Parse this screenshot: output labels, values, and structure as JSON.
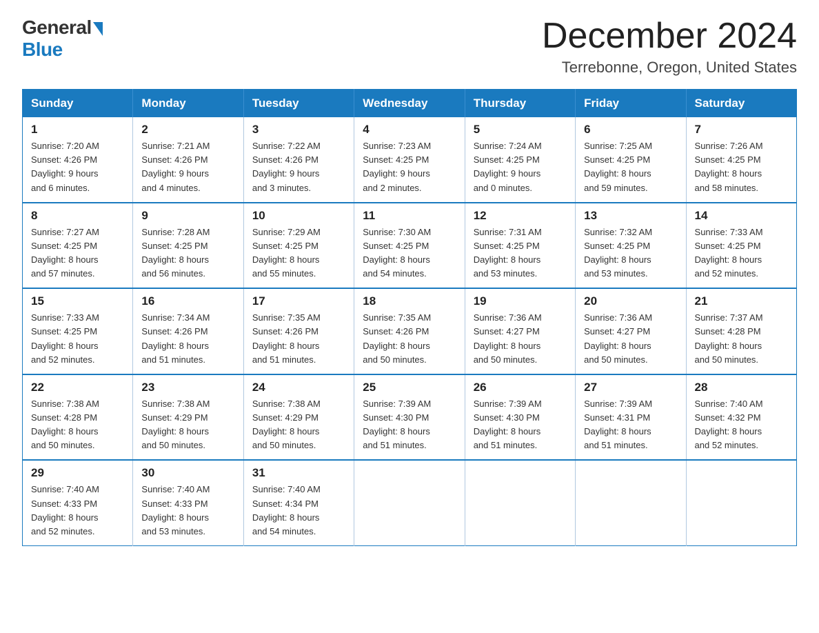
{
  "logo": {
    "general": "General",
    "blue": "Blue"
  },
  "title": {
    "month": "December 2024",
    "location": "Terrebonne, Oregon, United States"
  },
  "weekdays": [
    "Sunday",
    "Monday",
    "Tuesday",
    "Wednesday",
    "Thursday",
    "Friday",
    "Saturday"
  ],
  "weeks": [
    [
      {
        "day": "1",
        "sunrise": "7:20 AM",
        "sunset": "4:26 PM",
        "daylight": "9 hours and 6 minutes."
      },
      {
        "day": "2",
        "sunrise": "7:21 AM",
        "sunset": "4:26 PM",
        "daylight": "9 hours and 4 minutes."
      },
      {
        "day": "3",
        "sunrise": "7:22 AM",
        "sunset": "4:26 PM",
        "daylight": "9 hours and 3 minutes."
      },
      {
        "day": "4",
        "sunrise": "7:23 AM",
        "sunset": "4:25 PM",
        "daylight": "9 hours and 2 minutes."
      },
      {
        "day": "5",
        "sunrise": "7:24 AM",
        "sunset": "4:25 PM",
        "daylight": "9 hours and 0 minutes."
      },
      {
        "day": "6",
        "sunrise": "7:25 AM",
        "sunset": "4:25 PM",
        "daylight": "8 hours and 59 minutes."
      },
      {
        "day": "7",
        "sunrise": "7:26 AM",
        "sunset": "4:25 PM",
        "daylight": "8 hours and 58 minutes."
      }
    ],
    [
      {
        "day": "8",
        "sunrise": "7:27 AM",
        "sunset": "4:25 PM",
        "daylight": "8 hours and 57 minutes."
      },
      {
        "day": "9",
        "sunrise": "7:28 AM",
        "sunset": "4:25 PM",
        "daylight": "8 hours and 56 minutes."
      },
      {
        "day": "10",
        "sunrise": "7:29 AM",
        "sunset": "4:25 PM",
        "daylight": "8 hours and 55 minutes."
      },
      {
        "day": "11",
        "sunrise": "7:30 AM",
        "sunset": "4:25 PM",
        "daylight": "8 hours and 54 minutes."
      },
      {
        "day": "12",
        "sunrise": "7:31 AM",
        "sunset": "4:25 PM",
        "daylight": "8 hours and 53 minutes."
      },
      {
        "day": "13",
        "sunrise": "7:32 AM",
        "sunset": "4:25 PM",
        "daylight": "8 hours and 53 minutes."
      },
      {
        "day": "14",
        "sunrise": "7:33 AM",
        "sunset": "4:25 PM",
        "daylight": "8 hours and 52 minutes."
      }
    ],
    [
      {
        "day": "15",
        "sunrise": "7:33 AM",
        "sunset": "4:25 PM",
        "daylight": "8 hours and 52 minutes."
      },
      {
        "day": "16",
        "sunrise": "7:34 AM",
        "sunset": "4:26 PM",
        "daylight": "8 hours and 51 minutes."
      },
      {
        "day": "17",
        "sunrise": "7:35 AM",
        "sunset": "4:26 PM",
        "daylight": "8 hours and 51 minutes."
      },
      {
        "day": "18",
        "sunrise": "7:35 AM",
        "sunset": "4:26 PM",
        "daylight": "8 hours and 50 minutes."
      },
      {
        "day": "19",
        "sunrise": "7:36 AM",
        "sunset": "4:27 PM",
        "daylight": "8 hours and 50 minutes."
      },
      {
        "day": "20",
        "sunrise": "7:36 AM",
        "sunset": "4:27 PM",
        "daylight": "8 hours and 50 minutes."
      },
      {
        "day": "21",
        "sunrise": "7:37 AM",
        "sunset": "4:28 PM",
        "daylight": "8 hours and 50 minutes."
      }
    ],
    [
      {
        "day": "22",
        "sunrise": "7:38 AM",
        "sunset": "4:28 PM",
        "daylight": "8 hours and 50 minutes."
      },
      {
        "day": "23",
        "sunrise": "7:38 AM",
        "sunset": "4:29 PM",
        "daylight": "8 hours and 50 minutes."
      },
      {
        "day": "24",
        "sunrise": "7:38 AM",
        "sunset": "4:29 PM",
        "daylight": "8 hours and 50 minutes."
      },
      {
        "day": "25",
        "sunrise": "7:39 AM",
        "sunset": "4:30 PM",
        "daylight": "8 hours and 51 minutes."
      },
      {
        "day": "26",
        "sunrise": "7:39 AM",
        "sunset": "4:30 PM",
        "daylight": "8 hours and 51 minutes."
      },
      {
        "day": "27",
        "sunrise": "7:39 AM",
        "sunset": "4:31 PM",
        "daylight": "8 hours and 51 minutes."
      },
      {
        "day": "28",
        "sunrise": "7:40 AM",
        "sunset": "4:32 PM",
        "daylight": "8 hours and 52 minutes."
      }
    ],
    [
      {
        "day": "29",
        "sunrise": "7:40 AM",
        "sunset": "4:33 PM",
        "daylight": "8 hours and 52 minutes."
      },
      {
        "day": "30",
        "sunrise": "7:40 AM",
        "sunset": "4:33 PM",
        "daylight": "8 hours and 53 minutes."
      },
      {
        "day": "31",
        "sunrise": "7:40 AM",
        "sunset": "4:34 PM",
        "daylight": "8 hours and 54 minutes."
      },
      null,
      null,
      null,
      null
    ]
  ]
}
